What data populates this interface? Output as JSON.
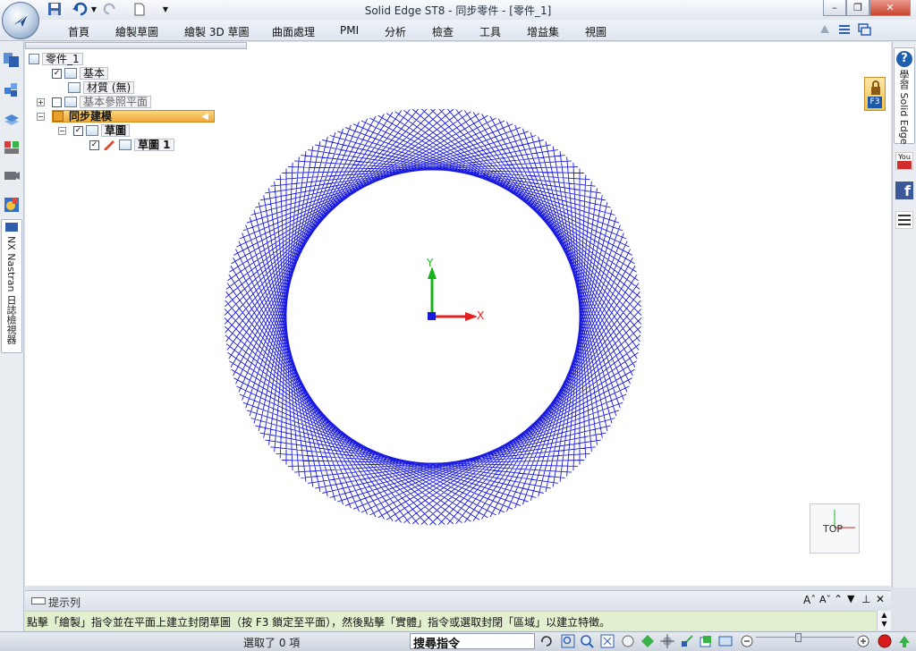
{
  "window": {
    "title": "Solid Edge ST8 - 同步零件 - [零件_1]",
    "minimize": "–",
    "restore": "❐",
    "close": "✕"
  },
  "ribbon": {
    "tabs": [
      "首頁",
      "繪製草圖",
      "繪製 3D 草圖",
      "曲面處理",
      "PMI",
      "分析",
      "檢查",
      "工具",
      "增益集",
      "視圖"
    ]
  },
  "tree": {
    "root": "零件_1",
    "base": "基本",
    "material": "材質 (無)",
    "ref_planes": "基本參照平面",
    "sync": "同步建模",
    "sketches": "草圖",
    "sketch1": "草圖 1",
    "check": "✓",
    "plus": "+",
    "minus": "−"
  },
  "left_strip": {
    "navigator_label": "NX Nastran 日誌檢視器"
  },
  "canvas": {
    "axis_y": "Y",
    "axis_x": "X",
    "view_cube": "TOP",
    "ring_color": "#1a1adf"
  },
  "right_dock": {
    "help": "?",
    "help_label": "學習 Solid Edge",
    "lock_key": "F3",
    "youtube": "You",
    "facebook": "f"
  },
  "prompt": {
    "title": "提示列",
    "message": "點擊「繪製」指令並在平面上建立封閉草圖（按 F3 鎖定至平面），然後點擊「實體」指令或選取封閉「區域」以建立特徵。"
  },
  "status": {
    "selection": "選取了 0 項",
    "command_search": "搜尋指令"
  }
}
